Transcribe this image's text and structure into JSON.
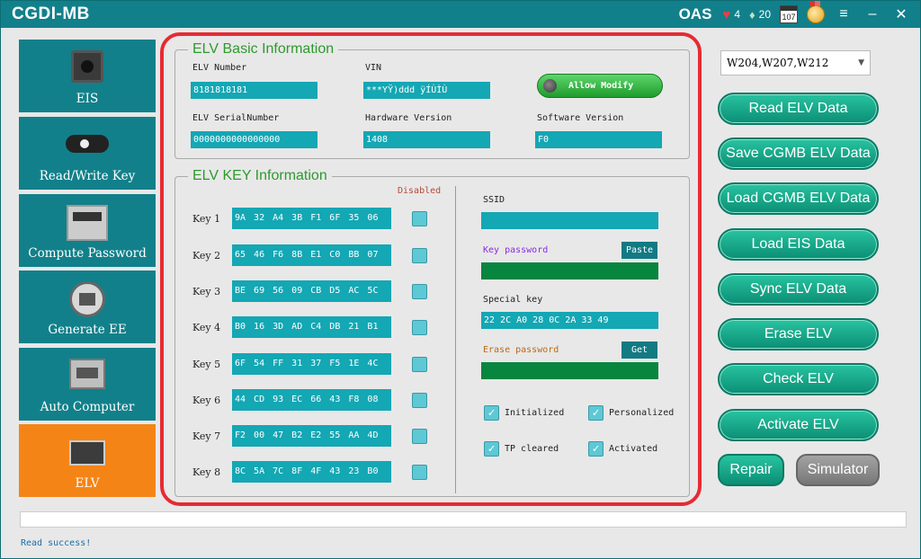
{
  "titlebar": {
    "title": "CGDI-MB",
    "oas": "OAS",
    "hearts": "4",
    "diamonds": "20",
    "calendar": "107"
  },
  "sidebar": {
    "items": [
      {
        "label": "EIS",
        "icon": "eis-icon",
        "active": false
      },
      {
        "label": "Read/Write Key",
        "icon": "car-key-icon",
        "active": false
      },
      {
        "label": "Compute Password",
        "icon": "calculator-icon",
        "active": false
      },
      {
        "label": "Generate EE",
        "icon": "printer-icon",
        "active": false
      },
      {
        "label": "Auto Computer",
        "icon": "ecu-icon",
        "active": false
      },
      {
        "label": "ELV",
        "icon": "elv-icon",
        "active": true
      }
    ]
  },
  "basic": {
    "title": "ELV Basic Information",
    "elv_number_label": "ELV Number",
    "elv_number": "8181818181",
    "vin_label": "VIN",
    "vin": "***YŸ)ddd ÿÍÙÌÙ",
    "allow_modify": "Allow Modify",
    "serial_label": "ELV SerialNumber",
    "serial": "0000000000000000",
    "hw_label": "Hardware Version",
    "hw": "1408",
    "sw_label": "Software Version",
    "sw": "F0"
  },
  "keyinfo": {
    "title": "ELV KEY Information",
    "disabled_label": "Disabled",
    "keys": [
      {
        "label": "Key 1",
        "value": "9A 32 A4 3B F1 6F 35 06"
      },
      {
        "label": "Key 2",
        "value": "65 46 F6 8B E1 C0 BB 07"
      },
      {
        "label": "Key 3",
        "value": "BE 69 56 09 CB D5 AC 5C"
      },
      {
        "label": "Key 4",
        "value": "B0 16 3D AD C4 DB 21 B1"
      },
      {
        "label": "Key 5",
        "value": "6F 54 FF 31 37 F5 1E 4C"
      },
      {
        "label": "Key 6",
        "value": "44 CD 93 EC 66 43 F8 08"
      },
      {
        "label": "Key 7",
        "value": "F2 00 47 B2 E2 55 AA 4D"
      },
      {
        "label": "Key 8",
        "value": "8C 5A 7C 8F 4F 43 23 B0"
      }
    ],
    "ssid_label": "SSID",
    "ssid": "",
    "key_password_label": "Key password",
    "key_password": "",
    "paste_label": "Paste",
    "special_key_label": "Special key",
    "special_key": "22 2C A0 28 0C 2A 33 49",
    "erase_password_label": "Erase password",
    "erase_password": "",
    "get_label": "Get",
    "checks": {
      "initialized": "Initialized",
      "personalized": "Personalized",
      "tp_cleared": "TP cleared",
      "activated": "Activated"
    }
  },
  "right": {
    "model": "W204,W207,W212",
    "buttons": [
      "Read  ELV Data",
      "Save CGMB ELV Data",
      "Load CGMB ELV Data",
      "Load EIS Data",
      "Sync ELV Data",
      "Erase ELV",
      "Check ELV",
      "Activate ELV"
    ],
    "repair": "Repair",
    "simulator": "Simulator"
  },
  "status": "Read success!",
  "colors": {
    "teal": "#12808a",
    "field": "#14a7b4",
    "green_field": "#08853e",
    "active_orange": "#f58417",
    "highlight_red": "#e52b33"
  }
}
